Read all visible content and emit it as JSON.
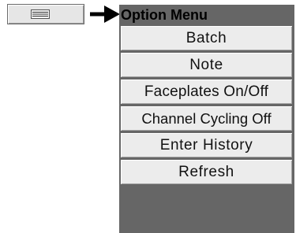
{
  "menu_button": {
    "icon": "hamburger-menu-icon"
  },
  "pointer": {
    "icon": "right-arrow-icon"
  },
  "option_menu": {
    "title": "Option Menu",
    "items": [
      {
        "label": "Batch"
      },
      {
        "label": "Note"
      },
      {
        "label": "Faceplates On/Off"
      },
      {
        "label": "Channel Cycling Off"
      },
      {
        "label": "Enter History"
      },
      {
        "label": "Refresh"
      }
    ]
  },
  "colors": {
    "menu_header_bg": "#666666",
    "item_bg": "#ececec",
    "button_bg": "#e6e6e6",
    "arrow": "#000000"
  }
}
